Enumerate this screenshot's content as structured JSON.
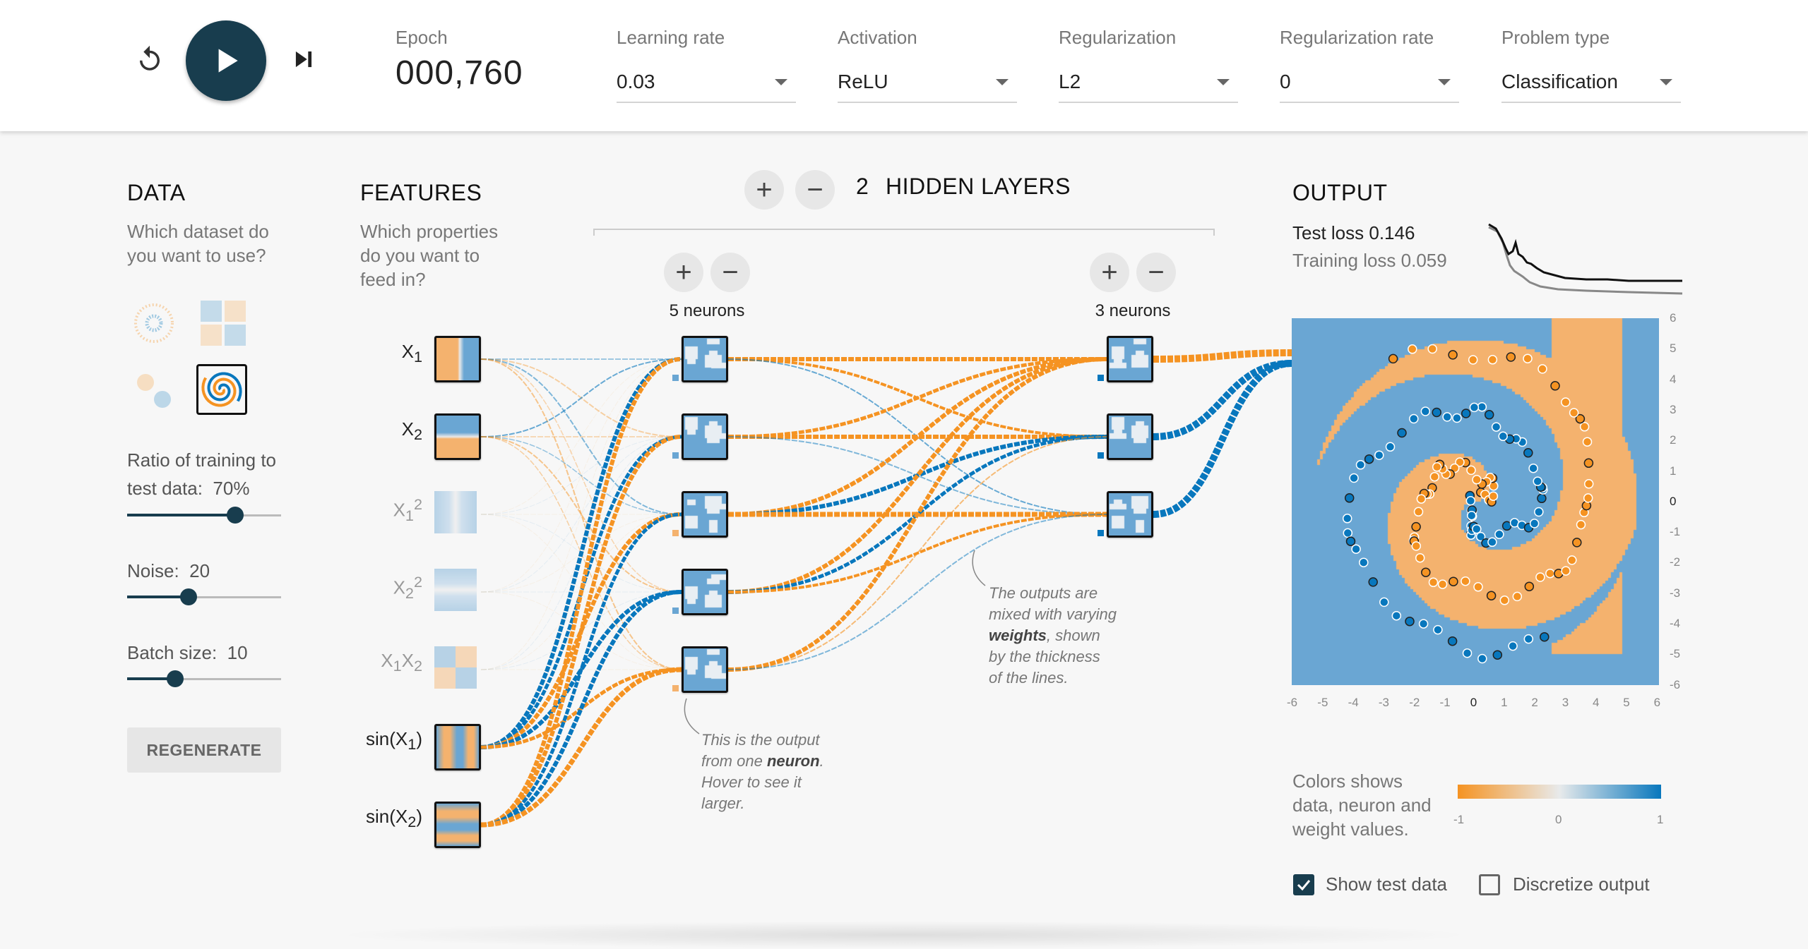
{
  "top": {
    "epoch_label": "Epoch",
    "epoch_value": "000,760",
    "learning_rate": {
      "label": "Learning rate",
      "value": "0.03"
    },
    "activation": {
      "label": "Activation",
      "value": "ReLU"
    },
    "regularization": {
      "label": "Regularization",
      "value": "L2"
    },
    "regularization_rate": {
      "label": "Regularization rate",
      "value": "0"
    },
    "problem_type": {
      "label": "Problem type",
      "value": "Classification"
    }
  },
  "data": {
    "title": "DATA",
    "description_1": "Which dataset do",
    "description_2": "you want to use?",
    "datasets": [
      "circle",
      "xor",
      "gaussian",
      "spiral"
    ],
    "selected_dataset": "spiral",
    "ratio_label": "Ratio of training to",
    "ratio_label_2": "test data:",
    "ratio_value": "70%",
    "ratio_fraction": 0.7,
    "noise_label": "Noise:",
    "noise_value": "20",
    "noise_fraction": 0.4,
    "batch_label": "Batch size:",
    "batch_value": "10",
    "batch_fraction": 0.31,
    "regenerate": "REGENERATE"
  },
  "features": {
    "title": "FEATURES",
    "description_1": "Which properties",
    "description_2": "do you want to",
    "description_3": "feed in?",
    "items": [
      {
        "label": "X",
        "sub": "1",
        "sup": "",
        "active": true
      },
      {
        "label": "X",
        "sub": "2",
        "sup": "",
        "active": true
      },
      {
        "label": "X",
        "sub": "1",
        "sup": "2",
        "active": false
      },
      {
        "label": "X",
        "sub": "2",
        "sup": "2",
        "active": false
      },
      {
        "label": "X",
        "sub": "1",
        "label2": "X",
        "sub2": "2",
        "active": false
      },
      {
        "label": "sin(X",
        "sub": "1",
        "tail": ")",
        "active": true
      },
      {
        "label": "sin(X",
        "sub": "2",
        "tail": ")",
        "active": true
      }
    ]
  },
  "network": {
    "hidden_layers_count": "2",
    "hidden_layers_label": "HIDDEN LAYERS",
    "layer1_neurons": "5 neurons",
    "layer2_neurons": "3 neurons",
    "plus": "+",
    "minus": "−",
    "annotation_neuron": [
      "This is the output",
      "from one",
      "neuron",
      ".",
      "Hover to see it",
      "larger."
    ],
    "annotation_weights": [
      "The outputs are",
      "mixed with varying",
      "weights",
      ", shown",
      "by the thickness",
      "of the lines."
    ]
  },
  "output": {
    "title": "OUTPUT",
    "test_loss": "Test loss 0.146",
    "training_loss": "Training loss 0.059",
    "y_ticks": [
      "6",
      "5",
      "4",
      "3",
      "2",
      "1",
      "0",
      "-1",
      "-2",
      "-3",
      "-4",
      "-5",
      "-6"
    ],
    "x_ticks": [
      "-6",
      "-5",
      "-4",
      "-3",
      "-2",
      "-1",
      "0",
      "1",
      "2",
      "3",
      "4",
      "5",
      "6"
    ],
    "legend_text": [
      "Colors shows",
      "data, neuron and",
      "weight values."
    ],
    "legend_min": "-1",
    "legend_mid": "0",
    "legend_max": "1",
    "show_test_data": "Show test data",
    "show_test_data_checked": true,
    "discretize": "Discretize output",
    "discretize_checked": false
  },
  "colors": {
    "orange": "#f59322",
    "blue": "#0877bd",
    "dark": "#183d4e",
    "light_orange": "#f4b26e",
    "light_blue": "#6aa6d3"
  }
}
